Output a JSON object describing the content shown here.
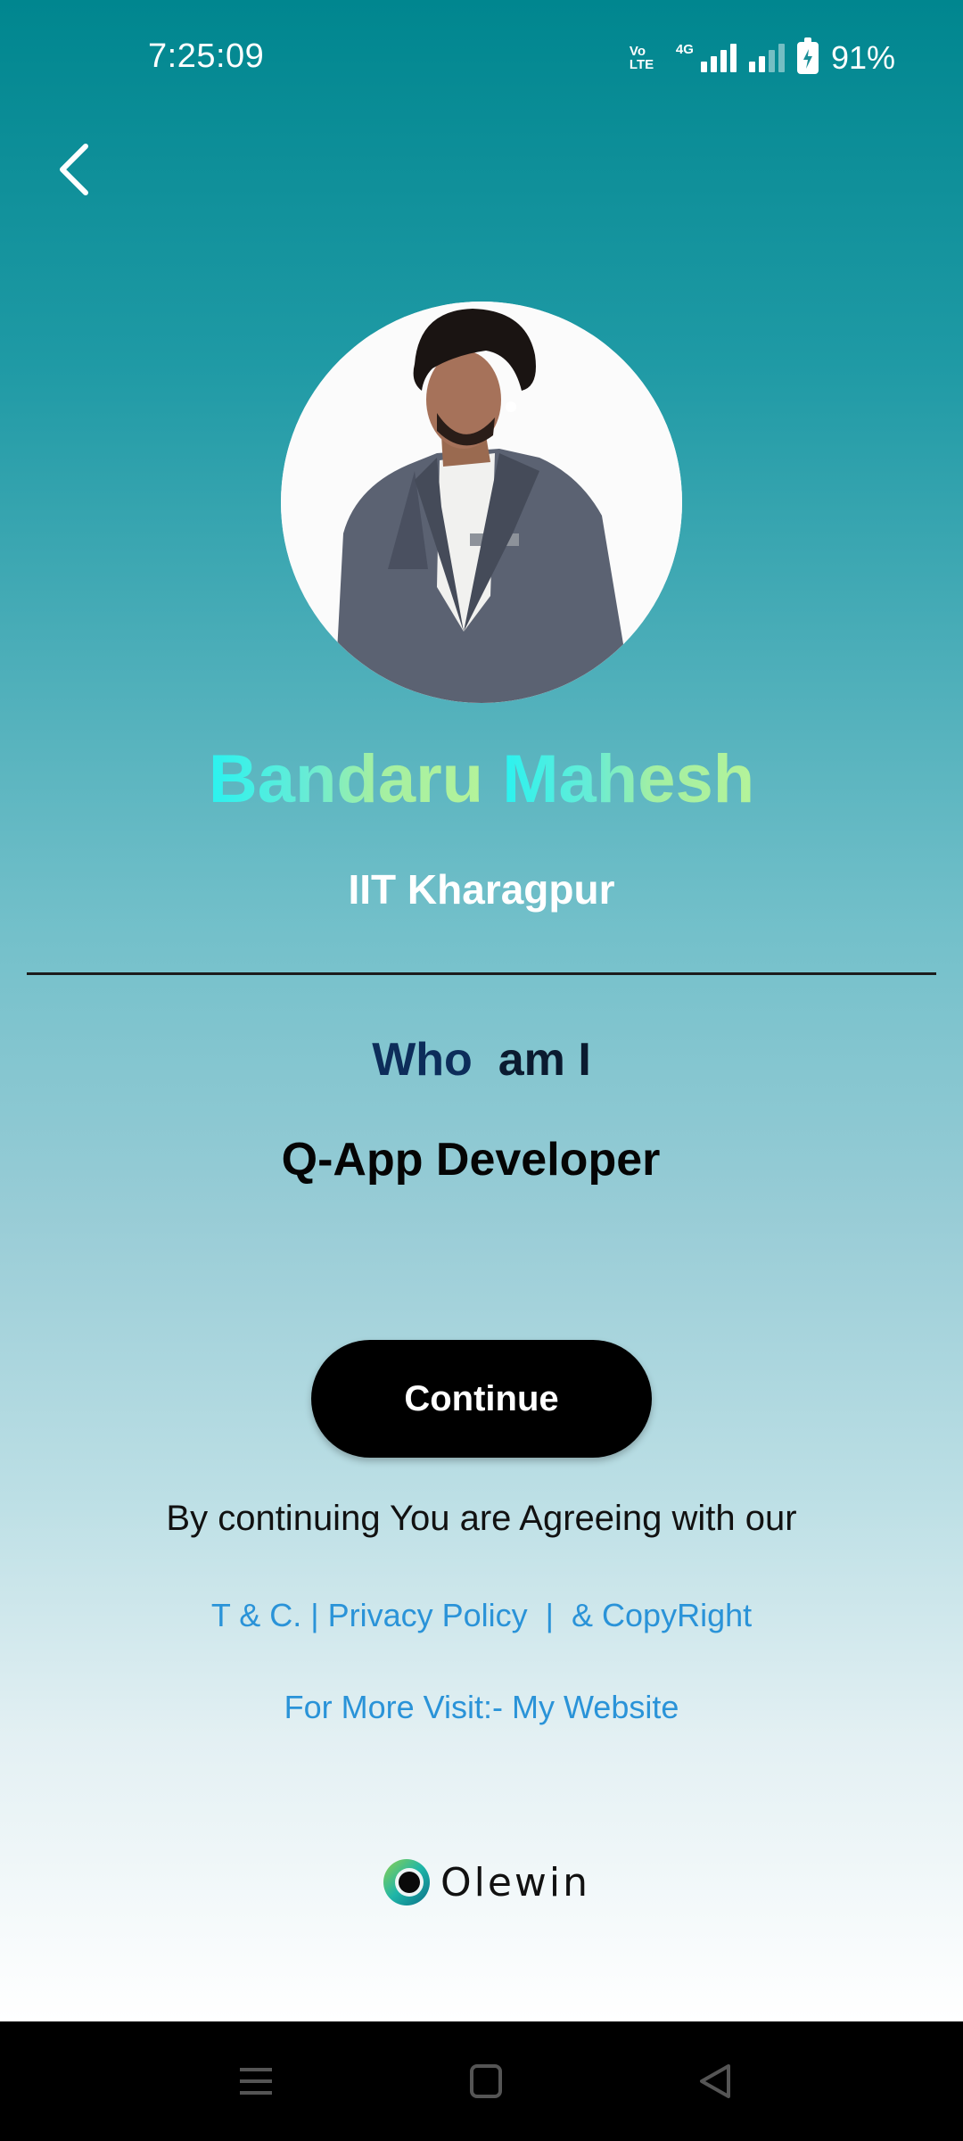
{
  "status_bar": {
    "time": "7:25:09",
    "volte": "Vo LTE",
    "network": "4G",
    "battery": "91%"
  },
  "profile": {
    "name_first": "Bandaru",
    "name_last": "Mahesh",
    "college": "IIT Kharagpur",
    "who_label_1": "Who",
    "who_label_2": "am I",
    "role": "Q-App Developer"
  },
  "actions": {
    "continue_label": "Continue",
    "agree_text": "By continuing You are Agreeing with our",
    "tc_link": "T & C.",
    "privacy_link": "Privacy Policy",
    "copyright_link": "& CopyRight",
    "more_visit": "For More Visit:- My Website"
  },
  "brand": {
    "name": "Olewin"
  },
  "colors": {
    "gradient_top": "#00868f",
    "gradient_bottom": "#ffffff",
    "link": "#2a93d8",
    "button": "#000000"
  },
  "icons": {
    "back": "chevron-left-icon",
    "nav_menu": "menu-icon",
    "nav_home": "square-home-icon",
    "nav_back": "triangle-back-icon"
  }
}
